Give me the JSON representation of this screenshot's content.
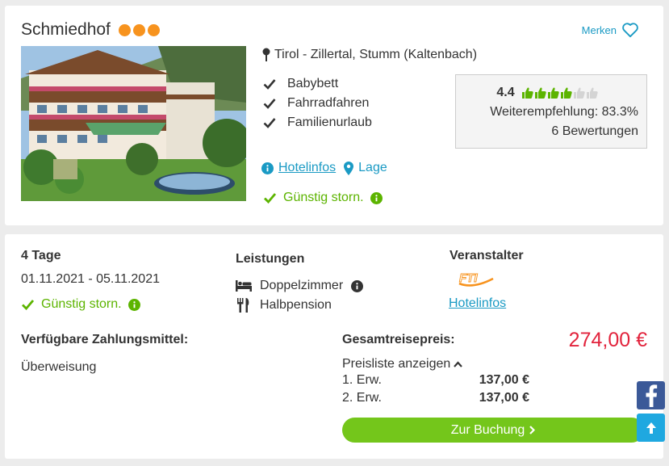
{
  "hotel": {
    "name": "Schmiedhof",
    "star_count": 3,
    "merken_label": "Merken",
    "location": "Tirol - Zillertal, Stumm (Kaltenbach)",
    "features": [
      "Babybett",
      "Fahrradfahren",
      "Familienurlaub"
    ],
    "rating": {
      "score": "4.4",
      "thumbs_filled": 4.4,
      "thumbs_total": 6,
      "recommendation": "Weiterempfehlung: 83.3%",
      "reviews": "6 Bewertungen"
    },
    "link_hotelinfos": "Hotelinfos",
    "link_lage": "Lage",
    "storno": "Günstig storn."
  },
  "offer": {
    "days": "4 Tage",
    "dates": "01.11.2021 - 05.11.2021",
    "storno": "Günstig storn.",
    "leistungen_title": "Leistungen",
    "leistungen": [
      "Doppelzimmer",
      "Halbpension"
    ],
    "veranstalter_title": "Veranstalter",
    "veranstalter_logo": "FTI",
    "veranstalter_link": "Hotelinfos",
    "zahlung_title": "Verfügbare Zahlungsmittel:",
    "zahlung_value": "Überweisung",
    "gesamt_title": "Gesamtreisepreis:",
    "gesamt_price": "274,00 €",
    "preisliste_label": "Preisliste anzeigen",
    "price_rows": [
      {
        "label": "1. Erw.",
        "amount": "137,00 €"
      },
      {
        "label": "2. Erw.",
        "amount": "137,00 €"
      }
    ],
    "book_label": "Zur Buchung"
  },
  "colors": {
    "accent_blue": "#1a9ac4",
    "green": "#5cb400",
    "price_red": "#e2233c",
    "star_orange": "#f7931e",
    "button_green": "#74c61b"
  }
}
